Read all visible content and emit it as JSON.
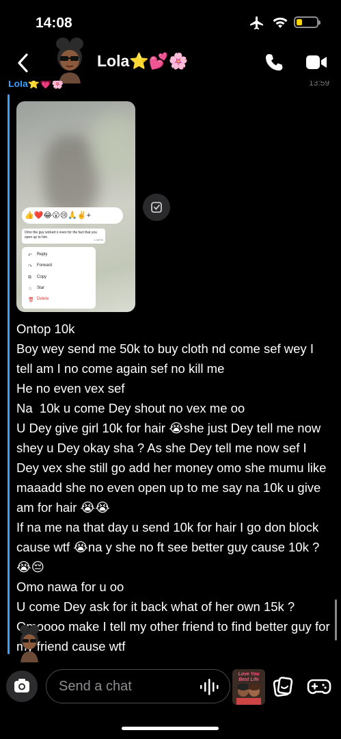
{
  "status_bar": {
    "time": "14:08"
  },
  "header": {
    "title": "Lola⭐💕🌸"
  },
  "message": {
    "sender": "Lola⭐💗🌸",
    "time": "13:59",
    "text": "Ontop 10k\nBoy wey send me 50k to buy cloth nd come sef wey I tell am I no come again sef no kill me\nHe no even vex sef\nNa  10k u come Dey shout no vex me oo\nU Dey give girl 10k for hair 😭she just Dey tell me now shey u Dey okay sha ? As she Dey tell me now sef I Dey vex she still go add her money omo she mumu like maaadd she no even open up to me say na 10k u give am for hair 😭😭\nIf na me na that day u send 10k for hair I go don block cause wtf 😭na y she no ft see better guy cause 10k ? 😭😔\nOmo nawa for u oo\nU come Dey ask for it back what of her own 15k ? Omoooo make I tell my other friend to find better guy for my friend cause wtf"
  },
  "screenshot_image": {
    "reactions": "👍❤️😂😮😢🙏✌️+",
    "quoted_text": "Omo the guy wicked o even for the fact that you open up to him",
    "quoted_time": "1:55PM",
    "menu": [
      {
        "icon": "reply-icon",
        "label": "Reply"
      },
      {
        "icon": "forward-icon",
        "label": "Forward"
      },
      {
        "icon": "copy-icon",
        "label": "Copy"
      },
      {
        "icon": "star-icon",
        "label": "Star"
      },
      {
        "icon": "trash-icon",
        "label": "Delete"
      }
    ]
  },
  "input": {
    "placeholder": "Send a chat",
    "bitmoji_caption": "Love You Best Life"
  },
  "colors": {
    "accent": "#3aa0ff",
    "battery": "#ffd60a",
    "background": "#000000"
  }
}
